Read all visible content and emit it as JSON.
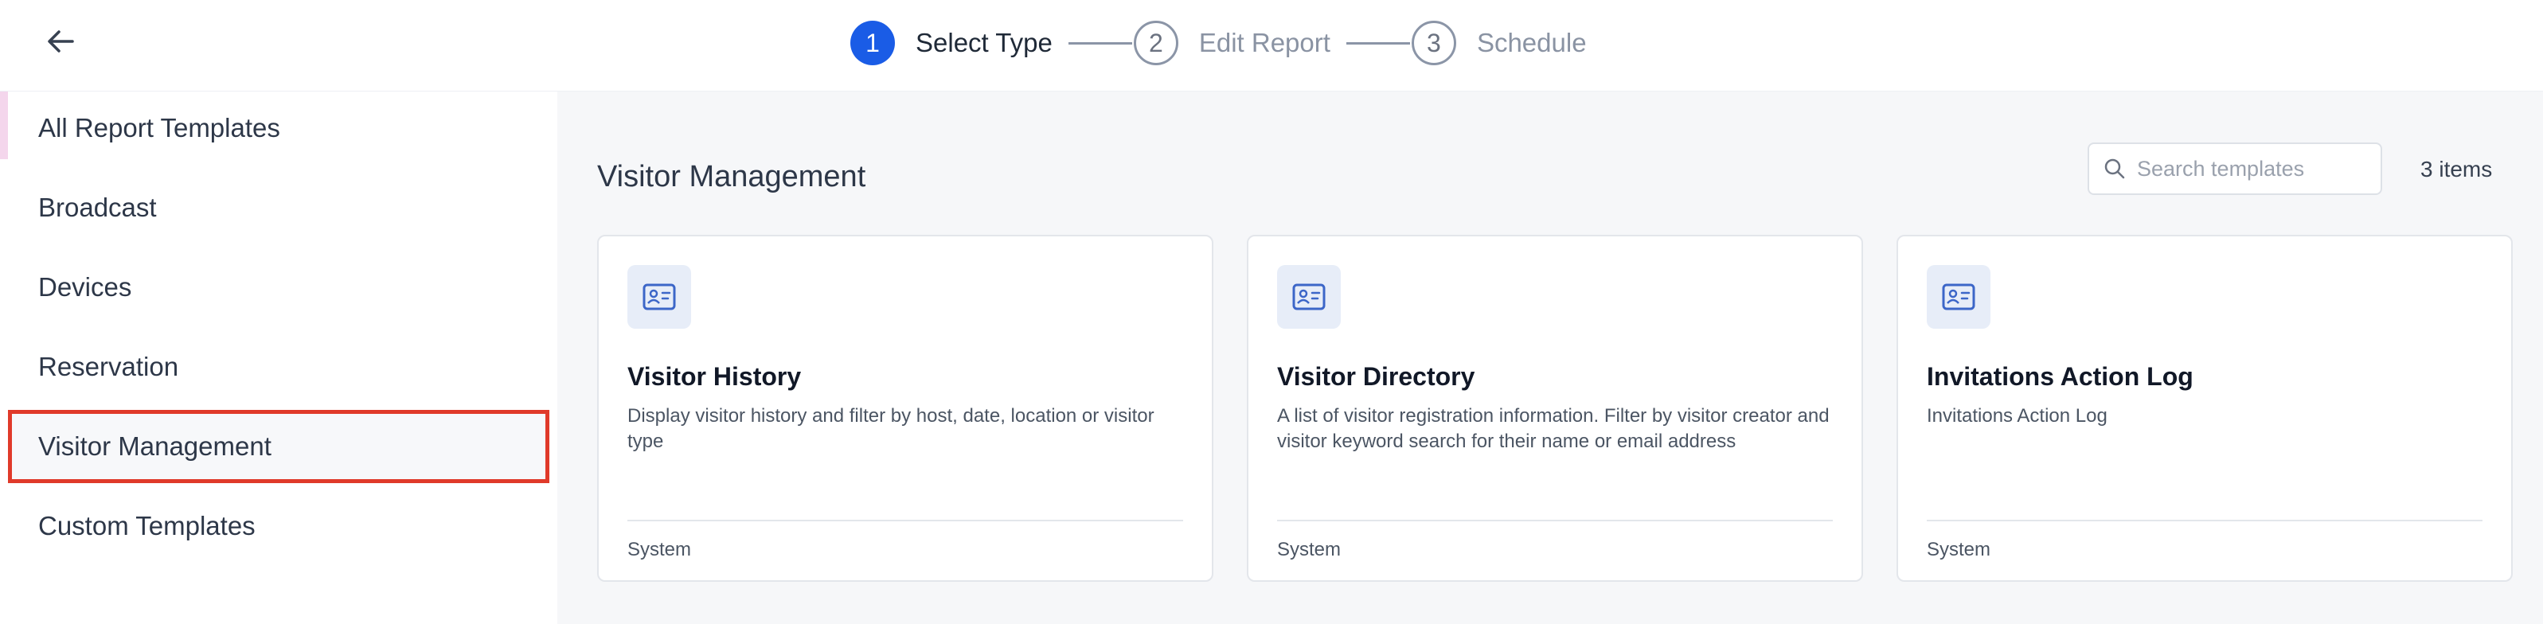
{
  "header": {
    "back_icon": "arrow-left-icon",
    "steps": [
      {
        "number": "1",
        "label": "Select Type",
        "state": "active"
      },
      {
        "number": "2",
        "label": "Edit Report",
        "state": "inactive"
      },
      {
        "number": "3",
        "label": "Schedule",
        "state": "inactive"
      }
    ]
  },
  "sidebar": {
    "items": [
      {
        "label": "All Report Templates"
      },
      {
        "label": "Broadcast"
      },
      {
        "label": "Devices"
      },
      {
        "label": "Reservation"
      },
      {
        "label": "Visitor Management",
        "selected": true
      },
      {
        "label": "Custom Templates"
      }
    ]
  },
  "main": {
    "title": "Visitor Management",
    "search": {
      "placeholder": "Search templates",
      "value": ""
    },
    "count": "3 items",
    "cards": [
      {
        "icon": "id-card-icon",
        "title": "Visitor History",
        "description": "Display visitor history and filter by host, date, location or visitor type",
        "footer": "System"
      },
      {
        "icon": "id-card-icon",
        "title": "Visitor Directory",
        "description": "A list of visitor registration information. Filter by visitor creator and visitor keyword search for their name or email address",
        "footer": "System"
      },
      {
        "icon": "id-card-icon",
        "title": "Invitations Action Log",
        "description": "Invitations Action Log",
        "footer": "System"
      }
    ]
  },
  "colors": {
    "accent": "#1a5ce6",
    "selection_border": "#e03a2a",
    "icon_tint": "#3c66c8"
  }
}
